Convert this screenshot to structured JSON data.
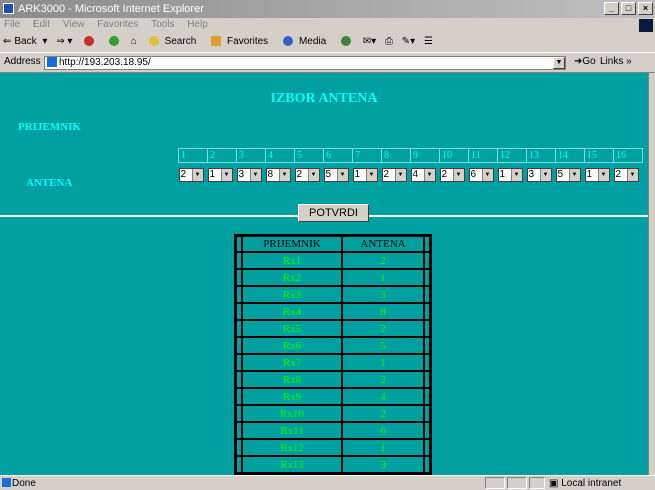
{
  "window": {
    "title": "ARK3000 - Microsoft Internet Explorer",
    "btn_min": "_",
    "btn_max": "□",
    "btn_close": "×"
  },
  "menubar": [
    "File",
    "Edit",
    "View",
    "Favorites",
    "Tools",
    "Help"
  ],
  "toolbar": {
    "back": "Back",
    "search": "Search",
    "favorites": "Favorites",
    "media": "Media"
  },
  "address": {
    "label": "Address",
    "url": "http://193.203.18.95/",
    "go": "Go",
    "links": "Links"
  },
  "page": {
    "heading": "IZBOR ANTENA",
    "receiver_label": "PRIJEMNIK",
    "antenna_label": "ANTENA",
    "receivers": [
      "1",
      "2",
      "3",
      "4",
      "5",
      "6",
      "7",
      "8",
      "9",
      "10",
      "11",
      "12",
      "13",
      "14",
      "15",
      "16"
    ],
    "antenna_selected": [
      "2",
      "1",
      "3",
      "8",
      "2",
      "5",
      "1",
      "2",
      "4",
      "2",
      "6",
      "1",
      "3",
      "5",
      "1",
      "2"
    ],
    "confirm_button": "POTVRDI",
    "table": {
      "headers": [
        "PRIJEMNIK",
        "ANTENA"
      ],
      "rows": [
        [
          "Rx1",
          "2"
        ],
        [
          "Rx2",
          "1"
        ],
        [
          "Rx3",
          "3"
        ],
        [
          "Rx4",
          "8"
        ],
        [
          "Rx5",
          "2"
        ],
        [
          "Rx6",
          "5"
        ],
        [
          "Rx7",
          "1"
        ],
        [
          "Rx8",
          "2"
        ],
        [
          "Rx9",
          "4"
        ],
        [
          "Rx10",
          "2"
        ],
        [
          "Rx11",
          "6"
        ],
        [
          "Rx12",
          "1"
        ],
        [
          "Rx13",
          "3"
        ]
      ]
    }
  },
  "statusbar": {
    "left": "Done",
    "zone": "Local intranet"
  },
  "colors": {
    "content_bg": "#00a0a0",
    "heading": "#00ffff",
    "cell_text": "#00ff00"
  }
}
